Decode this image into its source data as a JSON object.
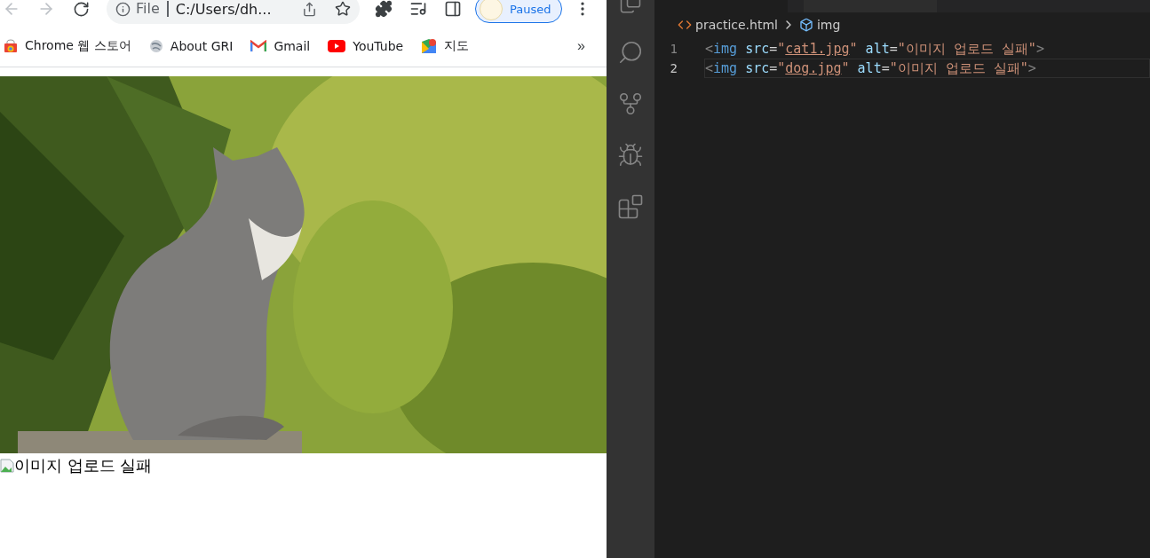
{
  "browser": {
    "address": {
      "scheme": "File",
      "url": "C:/Users/dh..."
    },
    "profile": {
      "label": "Paused"
    },
    "bookmarks": [
      {
        "label": "Chrome 웹 스토어",
        "kind": "store"
      },
      {
        "label": "About GRI",
        "kind": "globe"
      },
      {
        "label": "Gmail",
        "kind": "mail"
      },
      {
        "label": "YouTube",
        "kind": "video"
      },
      {
        "label": "지도",
        "kind": "map"
      }
    ],
    "overflow": "»"
  },
  "page": {
    "broken_image_alt": "이미지 업로드 실패"
  },
  "editor": {
    "breadcrumb": {
      "file": "practice.html",
      "symbol": "img"
    },
    "lines": [
      {
        "number": "1",
        "selected": false,
        "tokens": [
          {
            "kind": "punct",
            "text": "<"
          },
          {
            "kind": "tag",
            "text": "img"
          },
          {
            "kind": "attr",
            "text": " src"
          },
          {
            "kind": "plain",
            "text": "="
          },
          {
            "kind": "string",
            "text": "\""
          },
          {
            "kind": "link",
            "text": "cat1.jpg"
          },
          {
            "kind": "string",
            "text": "\""
          },
          {
            "kind": "attr",
            "text": " alt"
          },
          {
            "kind": "plain",
            "text": "="
          },
          {
            "kind": "string",
            "text": "\"이미지 업로드 실패\""
          },
          {
            "kind": "punct",
            "text": ">"
          }
        ]
      },
      {
        "number": "2",
        "selected": true,
        "tokens": [
          {
            "kind": "punct",
            "text": "<"
          },
          {
            "kind": "tag",
            "text": "img"
          },
          {
            "kind": "attr",
            "text": " src"
          },
          {
            "kind": "plain",
            "text": "="
          },
          {
            "kind": "string",
            "text": "\""
          },
          {
            "kind": "link",
            "text": "dog.jpg"
          },
          {
            "kind": "string",
            "text": "\""
          },
          {
            "kind": "attr",
            "text": " alt"
          },
          {
            "kind": "plain",
            "text": "="
          },
          {
            "kind": "string",
            "text": "\"이미지 업로드 실패\""
          },
          {
            "kind": "punct",
            "text": ">"
          }
        ]
      }
    ]
  }
}
